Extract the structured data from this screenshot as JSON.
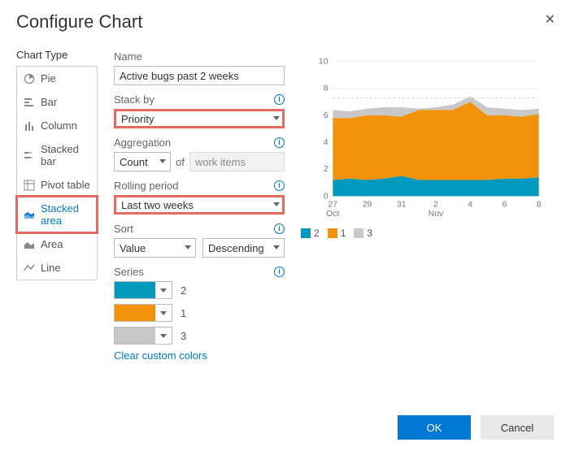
{
  "dialog": {
    "title": "Configure Chart",
    "close": "✕"
  },
  "sidebar": {
    "label": "Chart Type",
    "items": [
      {
        "label": "Pie",
        "selected": false
      },
      {
        "label": "Bar",
        "selected": false
      },
      {
        "label": "Column",
        "selected": false
      },
      {
        "label": "Stacked bar",
        "selected": false
      },
      {
        "label": "Pivot table",
        "selected": false
      },
      {
        "label": "Stacked area",
        "selected": true
      },
      {
        "label": "Area",
        "selected": false
      },
      {
        "label": "Line",
        "selected": false
      }
    ]
  },
  "form": {
    "name_label": "Name",
    "name_value": "Active bugs past 2 weeks",
    "stack_by_label": "Stack by",
    "stack_by_value": "Priority",
    "aggregation_label": "Aggregation",
    "aggregation_value": "Count",
    "aggregation_of": "of",
    "aggregation_field": "work items",
    "rolling_label": "Rolling period",
    "rolling_value": "Last two weeks",
    "sort_label": "Sort",
    "sort_field": "Value",
    "sort_dir": "Descending",
    "series_label": "Series",
    "series": [
      {
        "label": "2",
        "color": "#0099bc"
      },
      {
        "label": "1",
        "color": "#f2910a"
      },
      {
        "label": "3",
        "color": "#c8c8c8"
      }
    ],
    "clear_colors": "Clear custom colors"
  },
  "chart_data": {
    "type": "area",
    "title": "",
    "xlabel": "",
    "ylabel": "",
    "ylim": [
      0,
      10
    ],
    "yticks": [
      0,
      2,
      4,
      6,
      8,
      10
    ],
    "categories": [
      "27",
      "29",
      "31",
      "2",
      "4",
      "6",
      "8"
    ],
    "month_labels": {
      "27": "Oct",
      "2": "Nov"
    },
    "series": [
      {
        "name": "2",
        "color": "#0099bc",
        "values": [
          1.2,
          1.3,
          1.2,
          1.3,
          1.5,
          1.2,
          1.2,
          1.2,
          1.2,
          1.2,
          1.3,
          1.3,
          1.4
        ]
      },
      {
        "name": "1",
        "color": "#f2910a",
        "values": [
          5.8,
          5.8,
          6.0,
          6.0,
          5.9,
          6.4,
          6.4,
          6.4,
          7.0,
          6.0,
          6.0,
          5.9,
          6.1
        ]
      },
      {
        "name": "3",
        "color": "#c8c8c8",
        "values": [
          6.4,
          6.3,
          6.5,
          6.6,
          6.6,
          6.5,
          6.6,
          6.8,
          7.4,
          6.6,
          6.5,
          6.4,
          6.5
        ]
      }
    ],
    "dotted_line": 7.3
  },
  "legend": [
    {
      "label": "2",
      "color": "#0099bc"
    },
    {
      "label": "1",
      "color": "#f2910a"
    },
    {
      "label": "3",
      "color": "#c8c8c8"
    }
  ],
  "footer": {
    "ok": "OK",
    "cancel": "Cancel"
  }
}
